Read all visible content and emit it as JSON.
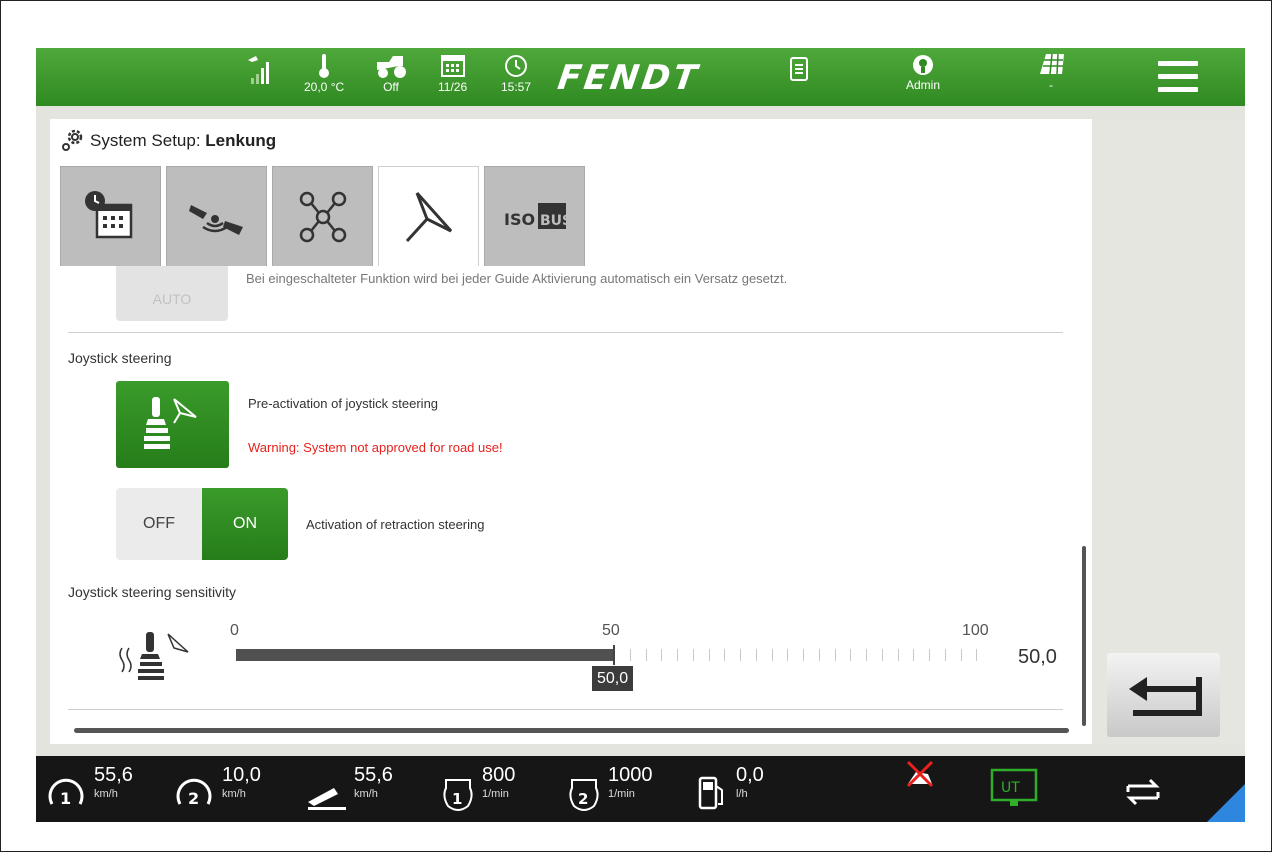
{
  "topbar": {
    "temperature": "20,0 °C",
    "tractor_status": "Off",
    "date": "11/26",
    "time": "15:57",
    "brand": "FENDT",
    "user": "Admin",
    "field": "-"
  },
  "header": {
    "title_prefix": "System Setup: ",
    "title_bold": "Lenkung",
    "tabs": [
      {
        "icon": "calendar-clock-icon"
      },
      {
        "icon": "satellite-icon"
      },
      {
        "icon": "network-icon"
      },
      {
        "icon": "steering-guide-icon",
        "active": true
      },
      {
        "icon": "isobus-icon",
        "text": "ISOBUS"
      }
    ]
  },
  "content": {
    "auto_button_label": "AUTO",
    "auto_description": "Bei eingeschalteter Funktion wird bei jeder Guide Aktivierung automatisch ein Versatz gesetzt.",
    "joystick_section": "Joystick steering",
    "preactivation_label": "Pre-activation of joystick steering",
    "warning": "Warning: System not approved for road use!",
    "toggle_off": "OFF",
    "toggle_on": "ON",
    "retraction_label": "Activation of retraction steering",
    "sensitivity_section": "Joystick steering sensitivity",
    "slider": {
      "min_label": "0",
      "mid_label": "50",
      "max_label": "100",
      "value": 50,
      "value_label": "50,0",
      "value_display": "50,0"
    }
  },
  "bottombar": {
    "speed1": {
      "value": "55,6",
      "unit": "km/h"
    },
    "speed2": {
      "value": "10,0",
      "unit": "km/h"
    },
    "speed3": {
      "value": "55,6",
      "unit": "km/h"
    },
    "rpm1": {
      "value": "800",
      "unit": "1/min"
    },
    "rpm2": {
      "value": "1000",
      "unit": "1/min"
    },
    "fuel": {
      "value": "0,0",
      "unit": "l/h"
    },
    "ut_label": "UT"
  },
  "colors": {
    "green": "#2f8a22",
    "warning": "#e8211d",
    "dark": "#161616",
    "accent": "#2e86de"
  }
}
